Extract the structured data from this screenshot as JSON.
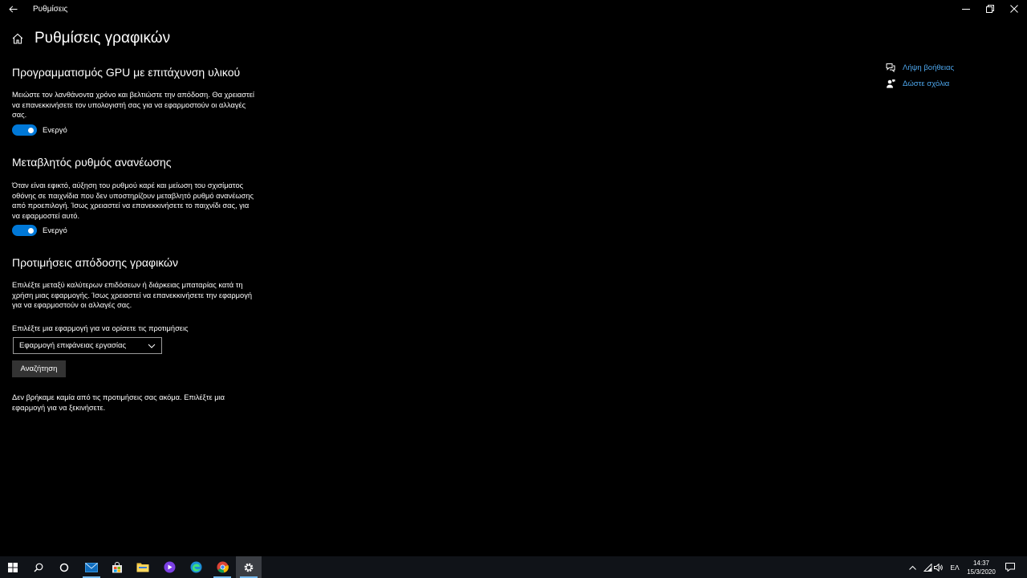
{
  "window": {
    "title": "Ρυθμίσεις"
  },
  "page": {
    "title": "Ρυθμίσεις γραφικών"
  },
  "gpu_scheduling": {
    "title": "Προγραμματισμός GPU με επιτάχυνση υλικού",
    "description": "Μειώστε τον λανθάνοντα χρόνο και βελτιώστε την απόδοση. Θα χρειαστεί να επανεκκινήσετε τον υπολογιστή σας για να εφαρμοστούν οι αλλαγές σας.",
    "toggle_state": "Ενεργό",
    "toggle_on": true
  },
  "variable_refresh": {
    "title": "Μεταβλητός ρυθμός ανανέωσης",
    "description": "Όταν είναι εφικτό, αύξηση του ρυθμού καρέ και μείωση του σχισίματος οθόνης σε παιχνίδια που δεν υποστηρίζουν μεταβλητό ρυθμό ανανέωσης από προεπιλογή. Ίσως χρειαστεί να επανεκκινήσετε το παιχνίδι σας, για να εφαρμοστεί αυτό.",
    "toggle_state": "Ενεργό",
    "toggle_on": true
  },
  "graphics_perf": {
    "title": "Προτιμήσεις απόδοσης γραφικών",
    "description": "Επιλέξτε μεταξύ καλύτερων επιδόσεων ή διάρκειας μπαταρίας κατά τη χρήση μιας εφαρμογής. Ίσως χρειαστεί να επανεκκινήσετε την εφαρμογή για να εφαρμοστούν οι αλλαγές σας.",
    "select_label": "Επιλέξτε μια εφαρμογή για να ορίσετε τις προτιμήσεις",
    "select_value": "Εφαρμογή επιφάνειας εργασίας",
    "search_button": "Αναζήτηση",
    "empty_message": "Δεν βρήκαμε καμία από τις προτιμήσεις σας ακόμα. Επιλέξτε μια εφαρμογή για να ξεκινήσετε."
  },
  "side_links": {
    "help": "Λήψη βοήθειας",
    "feedback": "Δώστε σχόλια"
  },
  "taskbar": {
    "language": "ΕΛ",
    "time": "14:37",
    "date": "15/3/2020"
  },
  "colors": {
    "accent": "#0078d7",
    "link": "#4ea8ef",
    "background": "#000000",
    "taskbar": "#101318"
  }
}
